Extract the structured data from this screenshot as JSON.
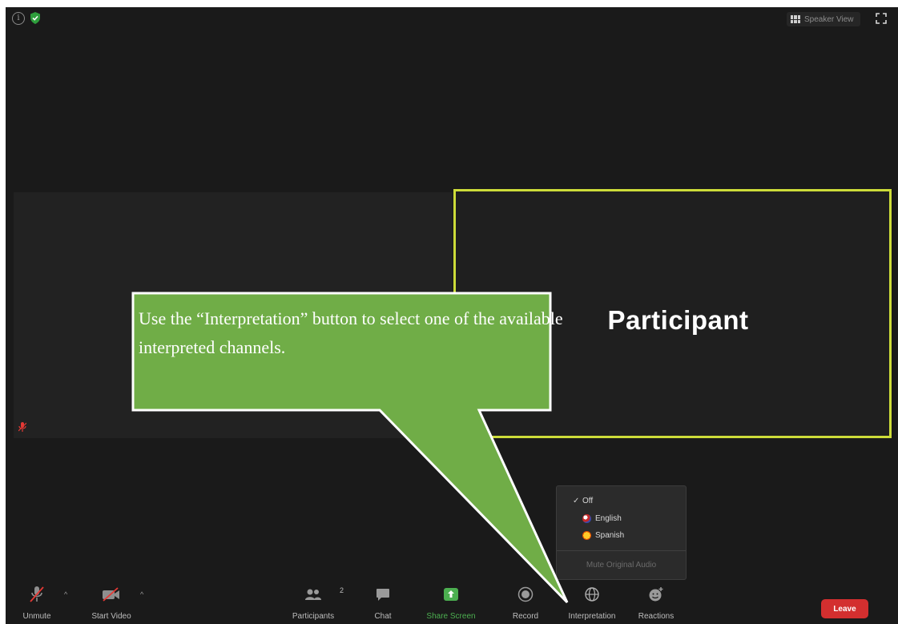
{
  "top_bar": {
    "info_icon": "info-icon",
    "shield_icon": "shield-icon",
    "speaker_view_label": "Speaker View",
    "fullscreen_icon": "fullscreen-icon"
  },
  "tiles": {
    "participant_name": "Participant",
    "active_border_color": "#cddc39"
  },
  "callout": {
    "text": "Use the “Interpretation” button to select one of the available interpreted channels.",
    "fill_color": "#70ad47",
    "border_color": "#ffffff"
  },
  "interpretation_menu": {
    "items": [
      {
        "label": "Off",
        "checked": true
      },
      {
        "label": "English",
        "icon": "flag-english-icon"
      },
      {
        "label": "Spanish",
        "icon": "flag-spanish-icon"
      }
    ],
    "mute_original": "Mute Original Audio"
  },
  "toolbar": {
    "unmute": "Unmute",
    "start_video": "Start Video",
    "participants": "Participants",
    "participants_count": "2",
    "chat": "Chat",
    "share_screen": "Share Screen",
    "record": "Record",
    "interpretation": "Interpretation",
    "reactions": "Reactions",
    "leave": "Leave"
  },
  "colors": {
    "share_green": "#4caf50",
    "leave_red": "#d32f2f",
    "background": "#1a1a1a"
  }
}
